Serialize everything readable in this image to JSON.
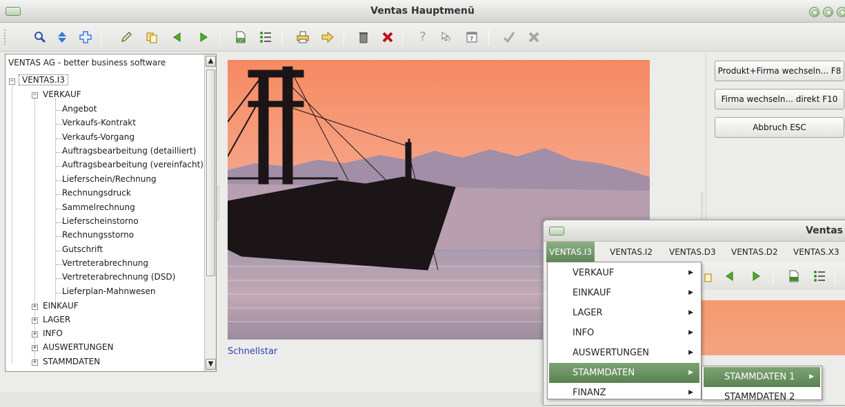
{
  "window": {
    "title": "Ventas Hauptmenü"
  },
  "toolbar": {
    "icons": [
      "search-icon",
      "up-down-icon",
      "move-icon",
      "edit-icon",
      "copy-icon",
      "previous-icon",
      "next-icon",
      "text-export-icon",
      "list-icon",
      "print-icon",
      "forward-icon",
      "trash-icon",
      "delete-icon",
      "help-icon",
      "context-help-icon",
      "calendar-icon",
      "checkmark-icon",
      "cancel-icon"
    ]
  },
  "tree": {
    "header": "VENTAS AG - better business software",
    "root": "VENTAS.I3",
    "verkauf": "VERKAUF",
    "verkauf_items": [
      "Angebot",
      "Verkaufs-Kontrakt",
      "Verkaufs-Vorgang",
      "Auftragsbearbeitung (detailliert)",
      "Auftragsbearbeitung (vereinfacht)",
      "Lieferschein/Rechnung",
      "Rechnungsdruck",
      "Sammelrechnung",
      "Lieferscheinstorno",
      "Rechnungsstorno",
      "Gutschrift",
      "Vertreterabrechnung",
      "Vertreterabrechnung (DSD)",
      "Lieferplan-Mahnwesen"
    ],
    "collapsed": [
      "EINKAUF",
      "LAGER",
      "INFO",
      "AUSWERTUNGEN",
      "STAMMDATEN"
    ]
  },
  "center": {
    "schnellstart": "Schnellstar"
  },
  "actions": {
    "produkt_firma": "Produkt+Firma wechseln... F8",
    "firma": "Firma wechseln... direkt F10",
    "abbruch": "Abbruch ESC"
  },
  "second_window": {
    "title": "Ventas",
    "menubar": [
      "VENTAS.I3",
      "VENTAS.I2",
      "VENTAS.D3",
      "VENTAS.D2",
      "VENTAS.X3"
    ],
    "dropdown": [
      "VERKAUF",
      "EINKAUF",
      "LAGER",
      "INFO",
      "AUSWERTUNGEN",
      "STAMMDATEN",
      "FINANZ"
    ],
    "submenu": [
      "STAMMDATEN 1",
      "STAMMDATEN 2"
    ]
  }
}
